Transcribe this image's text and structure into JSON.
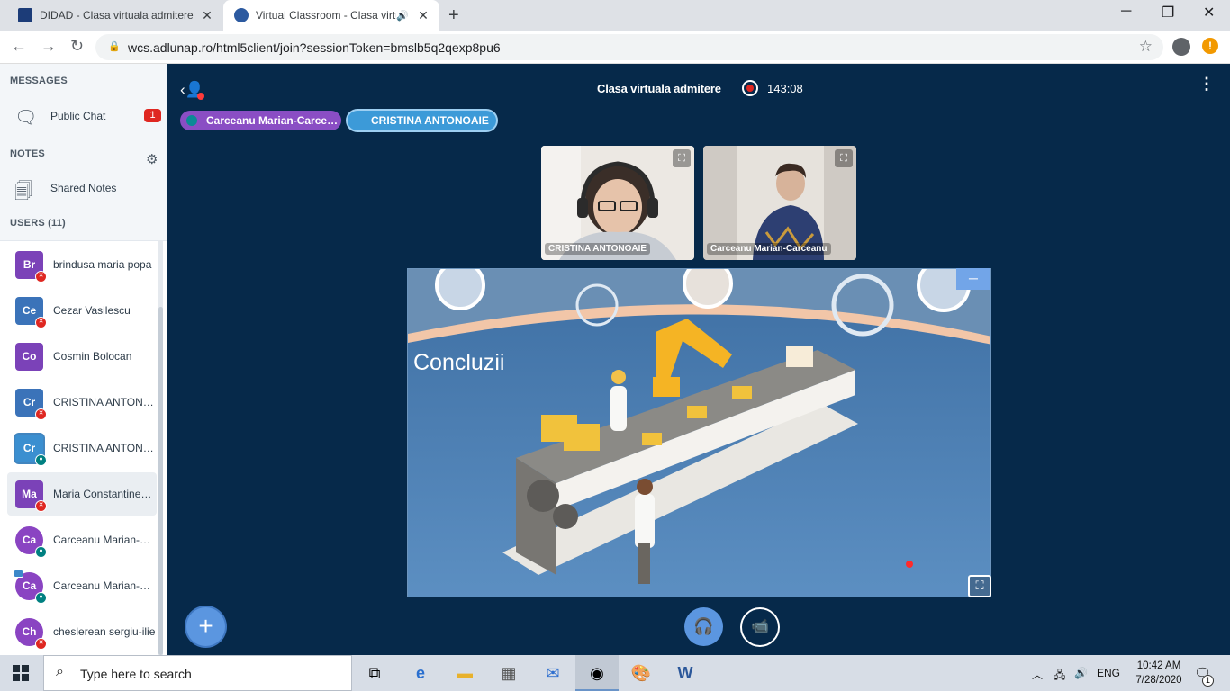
{
  "browser": {
    "tabs": [
      {
        "title": "DIDAD - Clasa virtuala admitere",
        "close": "✕"
      },
      {
        "title": "Virtual Classroom - Clasa virtu",
        "close": "✕"
      }
    ],
    "new_tab": "+",
    "url": "wcs.adlunap.ro/html5client/join?sessionToken=bmslb5q2qexp8pu6",
    "win_min": "─",
    "win_max": "❐",
    "win_close": "✕"
  },
  "sidebar": {
    "messages_header": "MESSAGES",
    "public_chat": "Public Chat",
    "unread_count": "1",
    "notes_header": "NOTES",
    "shared_notes": "Shared Notes",
    "users_header": "USERS (11)",
    "users": [
      {
        "initials": "Br",
        "name": "brindusa maria popa"
      },
      {
        "initials": "Ce",
        "name": "Cezar Vasilescu"
      },
      {
        "initials": "Co",
        "name": "Cosmin Bolocan"
      },
      {
        "initials": "Cr",
        "name": "CRISTINA ANTONOAIE"
      },
      {
        "initials": "Cr",
        "name": "CRISTINA ANTONOAIE"
      },
      {
        "initials": "Ma",
        "name": "Maria Constantinescu"
      },
      {
        "initials": "Ca",
        "name": "Carceanu Marian-Carceanu"
      },
      {
        "initials": "Ca",
        "name": "Carceanu Marian-Carceanu"
      },
      {
        "initials": "Ch",
        "name": "cheslerean sergiu-ilie"
      }
    ]
  },
  "meeting": {
    "title": "Clasa virtuala admitere",
    "timer": "143:08",
    "talkers": [
      "Carceanu Marian-Carceanu",
      "CRISTINA ANTONOAIE"
    ],
    "videos": [
      {
        "name": "CRISTINA ANTONOAIE"
      },
      {
        "name": "Carceanu Marian-Carceanu"
      }
    ],
    "slide_title": "Concluzii"
  },
  "taskbar": {
    "search_placeholder": "Type here to search",
    "language": "ENG",
    "time": "10:42 AM",
    "date": "7/28/2020",
    "notifications": "1"
  },
  "colors": {
    "app_bg": "#06294a",
    "moderator_purple": "#8a4ec4",
    "accent_blue": "#5b96e0",
    "muted_red": "#df2721",
    "unmuted_teal": "#008081"
  }
}
